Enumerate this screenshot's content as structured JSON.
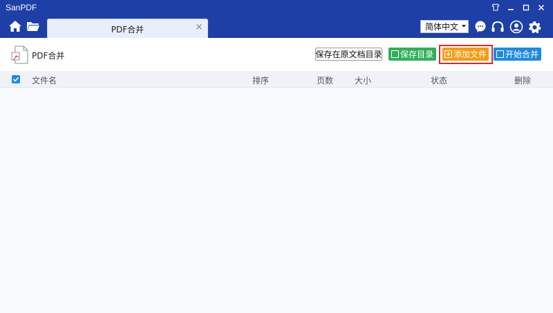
{
  "app": {
    "title": "SanPDF"
  },
  "window_controls": [
    "shirt-icon",
    "minimize-icon",
    "maximize-icon",
    "close-icon"
  ],
  "nav": {
    "tab_label": "PDF合并",
    "tab_close": "×",
    "language": "简体中文"
  },
  "toolbar": {
    "title": "PDF合并",
    "save_original_dir": "保存在原文档目录",
    "save_dir": "保存目录",
    "add_file": "添加文件",
    "start_merge": "开始合并"
  },
  "table": {
    "columns": [
      "文件名",
      "排序",
      "页数",
      "大小",
      "状态",
      "删除"
    ],
    "rows": []
  },
  "colors": {
    "header_bg": "#1d3fa6",
    "green": "#2fb05a",
    "orange": "#f39c12",
    "blue": "#1f8ae0",
    "highlight": "#e0252c"
  }
}
